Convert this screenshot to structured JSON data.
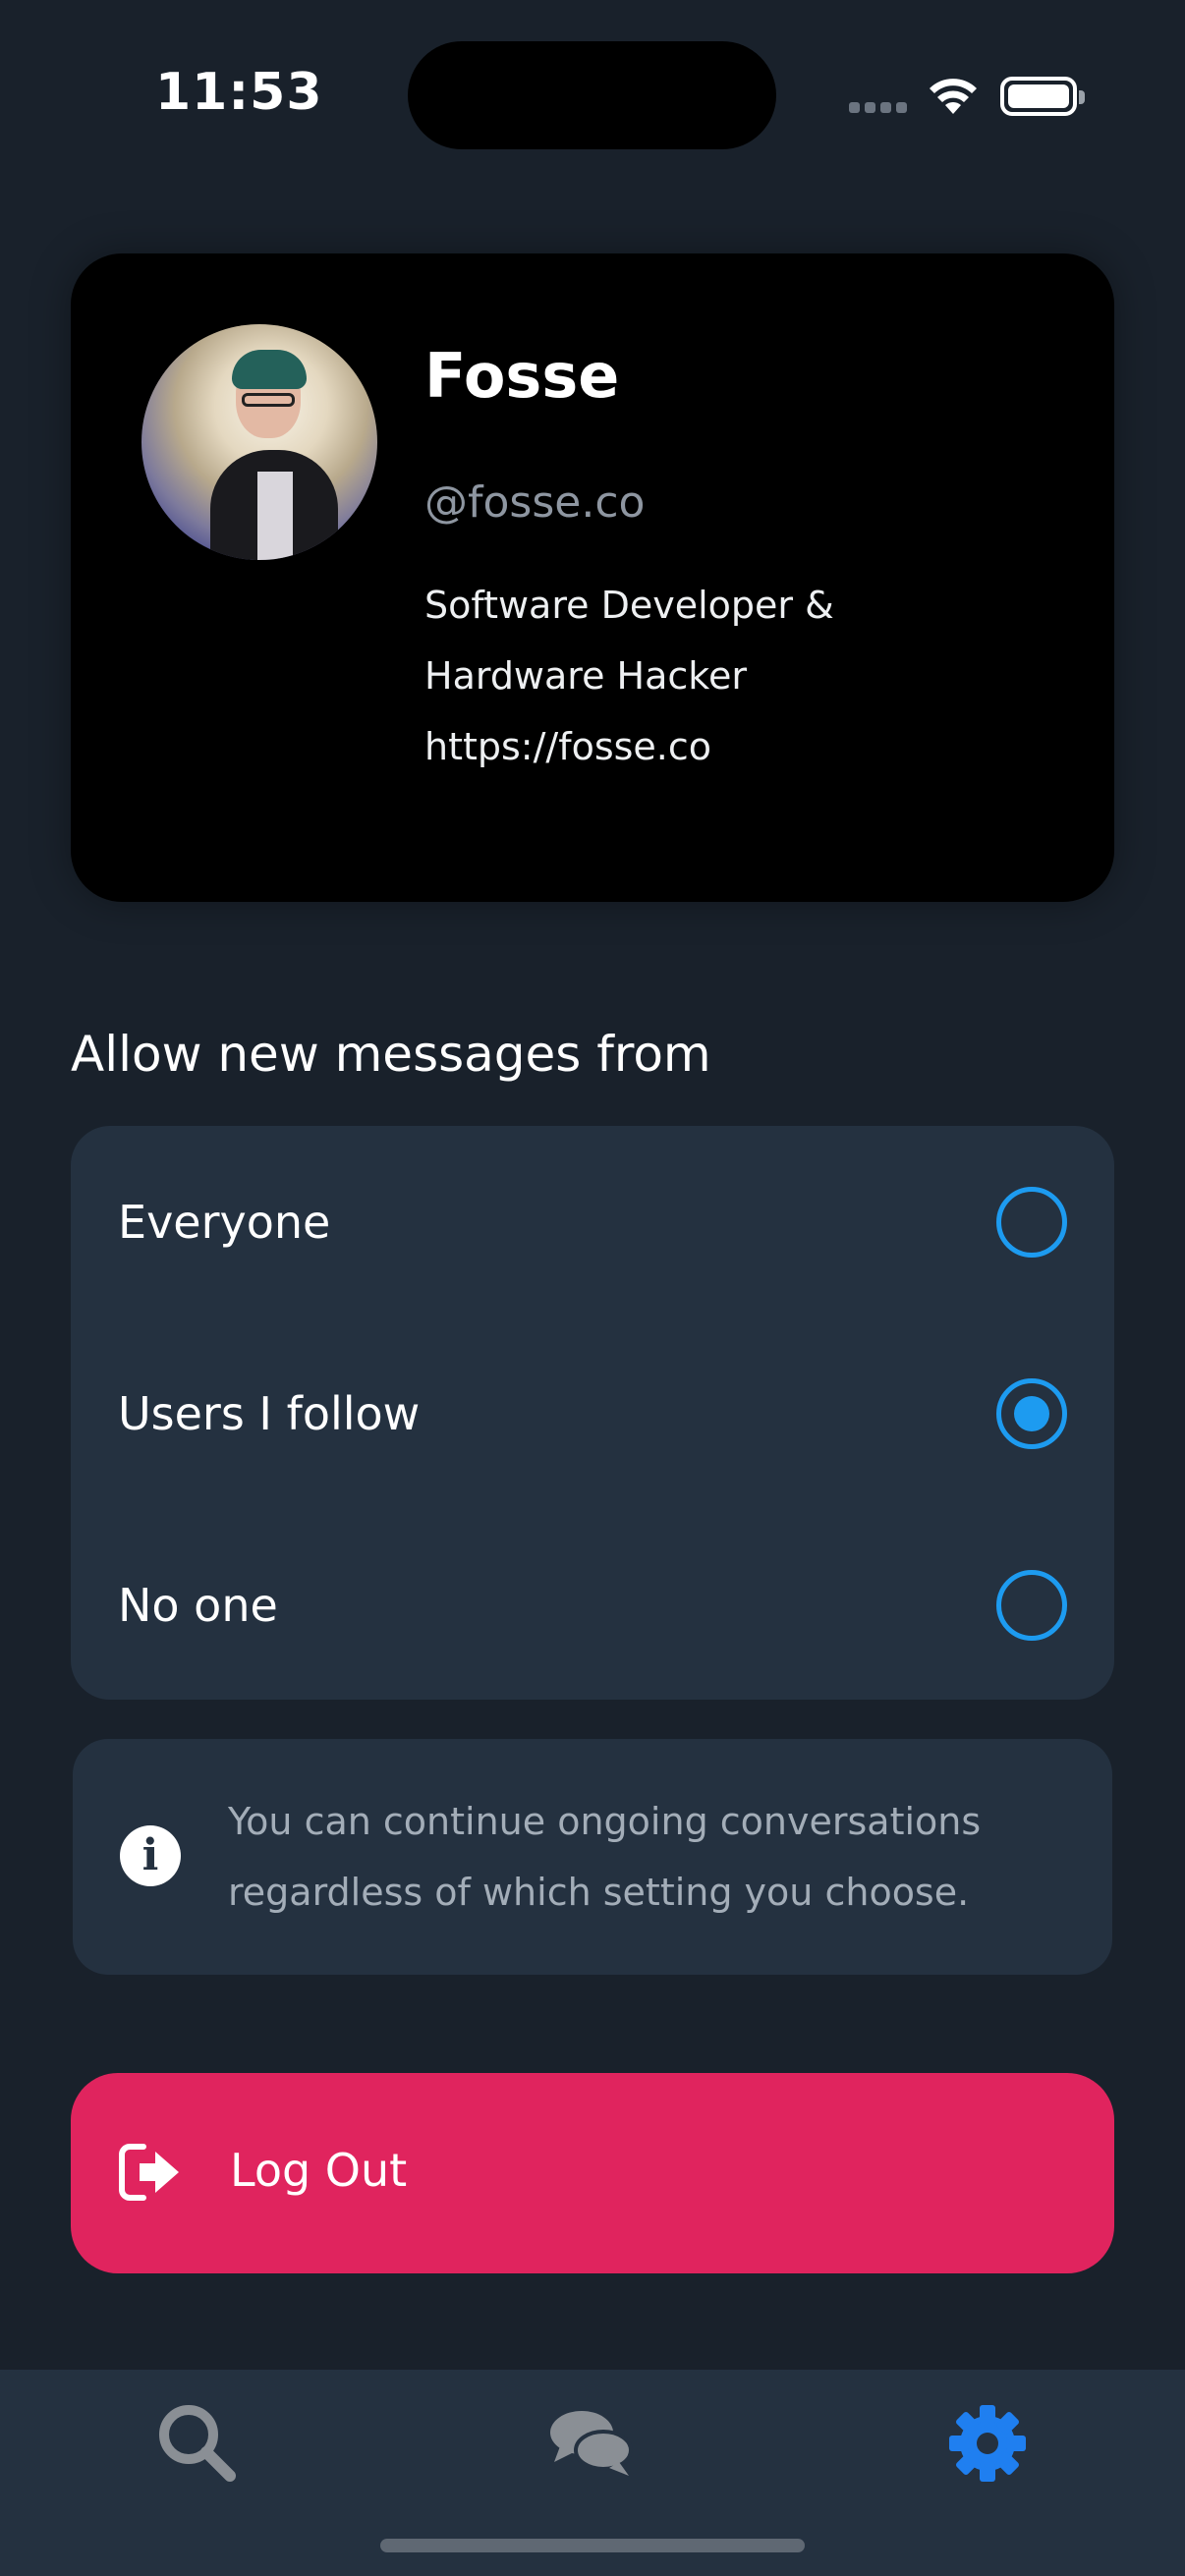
{
  "status_bar": {
    "time": "11:53"
  },
  "profile": {
    "name": "Fosse",
    "handle": "@fosse.co",
    "bio_line1": "Software Developer &",
    "bio_line2": "Hardware Hacker",
    "bio_line3": "https://fosse.co"
  },
  "messages": {
    "section_title": "Allow new messages from",
    "options": [
      {
        "label": "Everyone",
        "selected": false
      },
      {
        "label": "Users I follow",
        "selected": true
      },
      {
        "label": "No one",
        "selected": false
      }
    ],
    "info_text": "You can continue ongoing conversations regardless of which setting you choose."
  },
  "logout": {
    "label": "Log Out"
  },
  "tab_bar": {
    "items": [
      {
        "icon": "search-icon",
        "active": false
      },
      {
        "icon": "messages-icon",
        "active": false
      },
      {
        "icon": "gear-icon",
        "active": true
      }
    ]
  },
  "colors": {
    "background": "#19212b",
    "card": "#243140",
    "accent": "#1d9bf0",
    "danger": "#e0245e",
    "tab_active": "#1f7ff0",
    "tab_inactive": "#8a8f95"
  }
}
